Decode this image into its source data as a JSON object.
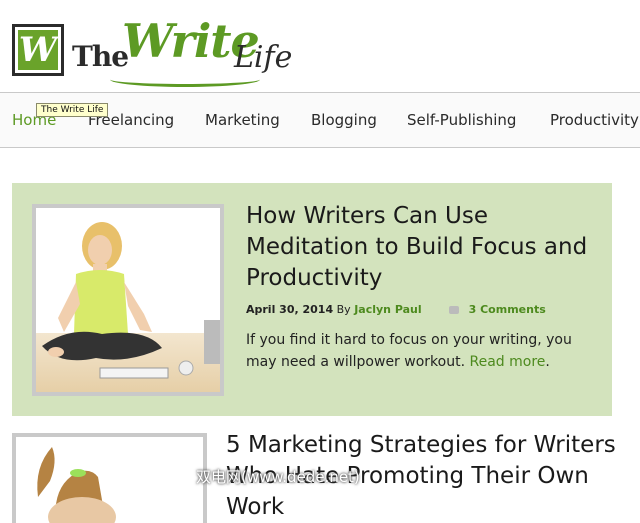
{
  "logo": {
    "letter": "W",
    "the": "The",
    "write": "Write",
    "life": "Life"
  },
  "tooltip": "The Write Life",
  "nav": {
    "items": [
      {
        "label": "Home",
        "active": true
      },
      {
        "label": "Freelancing"
      },
      {
        "label": "Marketing"
      },
      {
        "label": "Blogging"
      },
      {
        "label": "Self-Publishing"
      },
      {
        "label": "Productivity"
      }
    ]
  },
  "post1": {
    "title": "How Writers Can Use Meditation to Build Focus and Productivity",
    "date": "April 30, 2014",
    "by": "By",
    "author": "Jaclyn Paul",
    "comments": "3 Comments",
    "excerpt": "If you find it hard to focus on your writing, you may need a willpower workout.",
    "read_more": "Read more",
    "excerpt_end": "."
  },
  "post2": {
    "title": "5 Marketing Strategies for Writers Who Hate Promoting Their Own Work"
  },
  "watermark": "双电网(www.dede.net)",
  "colors": {
    "accent_green": "#5d9a24",
    "post_bg": "#d3e3bd"
  }
}
